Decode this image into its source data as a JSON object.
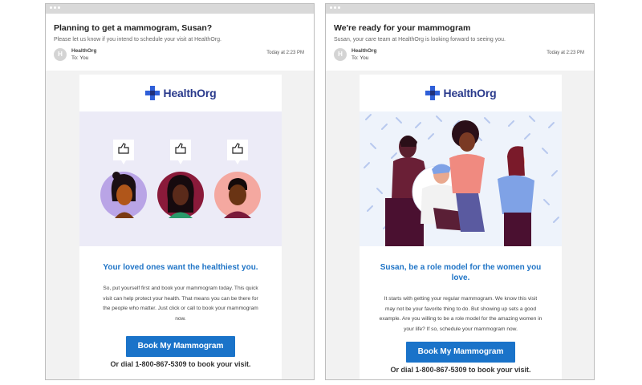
{
  "emails": [
    {
      "subject": "Planning to get a mammogram, Susan?",
      "preview": "Please let us know if you intend to schedule your visit at HealthOrg.",
      "avatar_initial": "H",
      "sender": "HealthOrg",
      "recipient": "To: You",
      "date": "Today at 2:23 PM",
      "brand": "HealthOrg",
      "hero": {
        "illustration": "three-faces-thumbs-up"
      },
      "headline": "Your loved ones want the healthiest you.",
      "body": "So, put yourself first and book your mammogram today. This quick visit can help protect your health. That means you can be there for the people who matter. Just click or call to book your mammogram now.",
      "cta_label": "Book My Mammogram",
      "dial_text": "Or dial 1-800-867-5309 to book your visit."
    },
    {
      "subject": "We're ready for your mammogram",
      "preview": "Susan, your care team at HealthOrg is looking forward to seeing you.",
      "avatar_initial": "H",
      "sender": "HealthOrg",
      "recipient": "To: You",
      "date": "Today at 2:23 PM",
      "brand": "HealthOrg",
      "hero": {
        "illustration": "group-of-women"
      },
      "headline": "Susan, be a role model for the women you love.",
      "body": "It starts with getting your regular mammogram. We know this visit may not be your favorite thing to do. But showing up sets a good example. Are you willing to be a role model for the amazing women in your life? If so, schedule your mammogram now.",
      "cta_label": "Book My Mammogram",
      "dial_text": "Or dial 1-800-867-5309 to book your visit."
    }
  ],
  "colors": {
    "brand_navy": "#2a3a8c",
    "logo_blue": "#2f5fd8",
    "logo_navy": "#1f2f7a",
    "headline_blue": "#1f74c6",
    "button_blue": "#1a73c9",
    "hero_left_bg": "#ecebf7",
    "hero_right_bg": "#eef3fb"
  }
}
